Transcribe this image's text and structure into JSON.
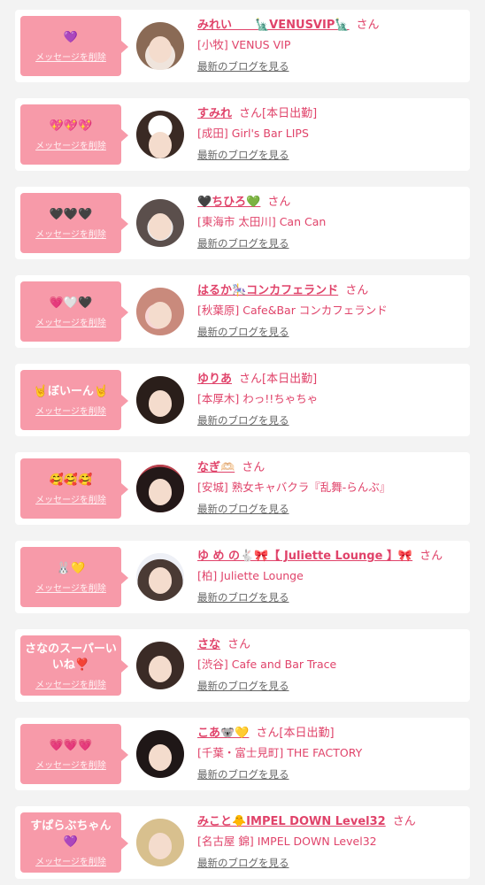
{
  "items": [
    {
      "message": "💜",
      "delete_label": "メッセージを削除",
      "name": "みれい　　🗽VENUSVIP🗽",
      "honorific": "さん",
      "status": "",
      "shop": "[小牧] VENUS VIP",
      "blog_link": "最新のブログを見る"
    },
    {
      "message": "💖💖💖",
      "delete_label": "メッセージを削除",
      "name": "すみれ",
      "honorific": "さん",
      "status": "[本日出勤]",
      "shop": "[成田] Girl's Bar LIPS",
      "blog_link": "最新のブログを見る"
    },
    {
      "message": "🖤🖤🖤",
      "delete_label": "メッセージを削除",
      "name": "🖤ちひろ💚",
      "honorific": "さん",
      "status": "",
      "shop": "[東海市 太田川] Can Can",
      "blog_link": "最新のブログを見る"
    },
    {
      "message": "💗🤍🖤",
      "delete_label": "メッセージを削除",
      "name": "はるか🎠コンカフェランド",
      "honorific": "さん",
      "status": "",
      "shop": "[秋葉原] Cafe&Bar コンカフェランド",
      "blog_link": "最新のブログを見る"
    },
    {
      "message": "🤘ぼいーん🤘",
      "delete_label": "メッセージを削除",
      "name": "ゆりあ",
      "honorific": "さん",
      "status": "[本日出勤]",
      "shop": "[本厚木] わっ!!ちゃちゃ",
      "blog_link": "最新のブログを見る"
    },
    {
      "message": "🥰🥰🥰",
      "delete_label": "メッセージを削除",
      "name": "なぎ🫶🏻",
      "honorific": "さん",
      "status": "",
      "shop": "[安城] 熟女キャバクラ『乱舞-らんぶ』",
      "blog_link": "最新のブログを見る"
    },
    {
      "message": "🐰💛",
      "delete_label": "メッセージを削除",
      "name": "ゆ め の🐇🎀【 Juliette Lounge 】🎀",
      "honorific": "さん",
      "status": "",
      "shop": "[柏] Juliette Lounge",
      "blog_link": "最新のブログを見る"
    },
    {
      "message": "さなのスーパーいいね❣️",
      "delete_label": "メッセージを削除",
      "name": "さな",
      "honorific": "さん",
      "status": "",
      "shop": "[渋谷] Cafe and Bar Trace",
      "blog_link": "最新のブログを見る"
    },
    {
      "message": "💗💗💗",
      "delete_label": "メッセージを削除",
      "name": "こあ🐨💛",
      "honorific": "さん",
      "status": "[本日出勤]",
      "shop": "[千葉・富士見町] THE FACTORY",
      "blog_link": "最新のブログを見る"
    },
    {
      "message": "すぱらぶちゃん💜",
      "delete_label": "メッセージを削除",
      "name": "みこと🐥IMPEL DOWN Level32",
      "honorific": "さん",
      "status": "",
      "shop": "[名古屋 錦] IMPEL DOWN Level32",
      "blog_link": "最新のブログを見る"
    }
  ]
}
